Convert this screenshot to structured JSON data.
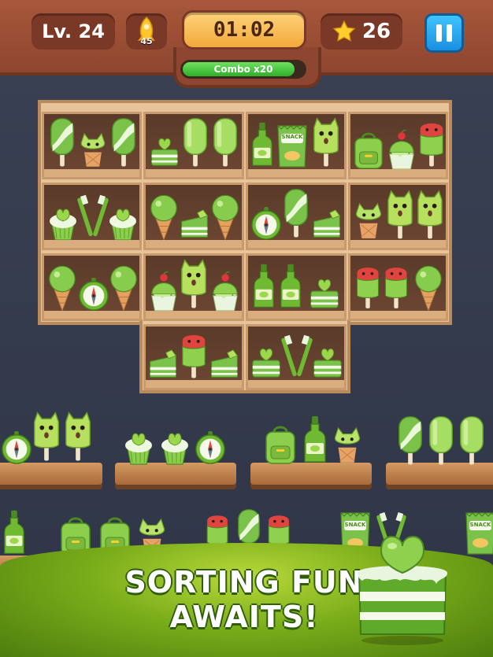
{
  "hud": {
    "level_label": "Lv. 24",
    "rocket_count": "45",
    "timer": "01:02",
    "stars": "26",
    "combo_label": "Combo x20",
    "combo_fraction": 0.92
  },
  "banner": {
    "line1": "SORTING FUN",
    "line2": "AWAITS!"
  },
  "item_labels": {
    "snack": "SNACK"
  },
  "colors": {
    "wood_top": "#a8573a",
    "timer": "#f2a93b",
    "pause": "#1b8fe0",
    "item_green": "#8fd14f",
    "banner_green": "#7aad1a"
  }
}
